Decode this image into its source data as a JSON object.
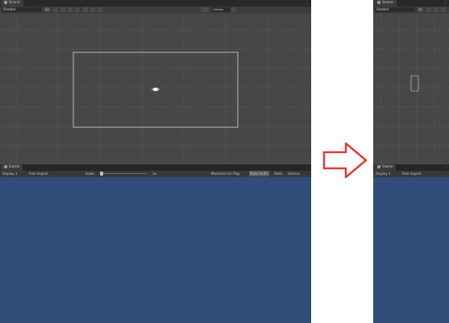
{
  "left_editor": {
    "scene_tab": {
      "label": "Scene",
      "icon": "scene-grid-icon"
    },
    "toolbar": {
      "shading_mode": "Shaded",
      "dim_toggle": "2D",
      "scene_camera": "Scene camera",
      "gizmos": "Gizmos"
    },
    "scene": {
      "camera_rect_icon": "camera-frustum-rect",
      "light_icon": "directional-light-icon"
    },
    "game_tab": {
      "label": "Game",
      "icon": "game-controller-icon"
    },
    "game_toolbar": {
      "display": "Display 1",
      "aspect": "Free Aspect",
      "scale_label": "Scale",
      "scale_value": "1x",
      "maximize_on_play": "Maximize On Play",
      "mute_audio": "Mute Audio",
      "stats": "Stats",
      "gizmos": "Gizmos"
    }
  },
  "arrow": {
    "icon": "right-arrow-icon",
    "color": "#e03a3a"
  },
  "right_editor": {
    "scene_tab": {
      "label": "Scene"
    },
    "toolbar": {
      "shading_mode": "Shaded",
      "dim_toggle": "2D"
    },
    "scene": {
      "camera_rect_icon": "portrait-camera-rect"
    },
    "game_tab": {
      "label": "Game"
    },
    "game_toolbar": {
      "display": "Display 1",
      "aspect": "Free Aspect"
    }
  },
  "colors": {
    "game_background": "#314d79",
    "scene_background": "#474747",
    "panel": "#3c3c3c"
  }
}
